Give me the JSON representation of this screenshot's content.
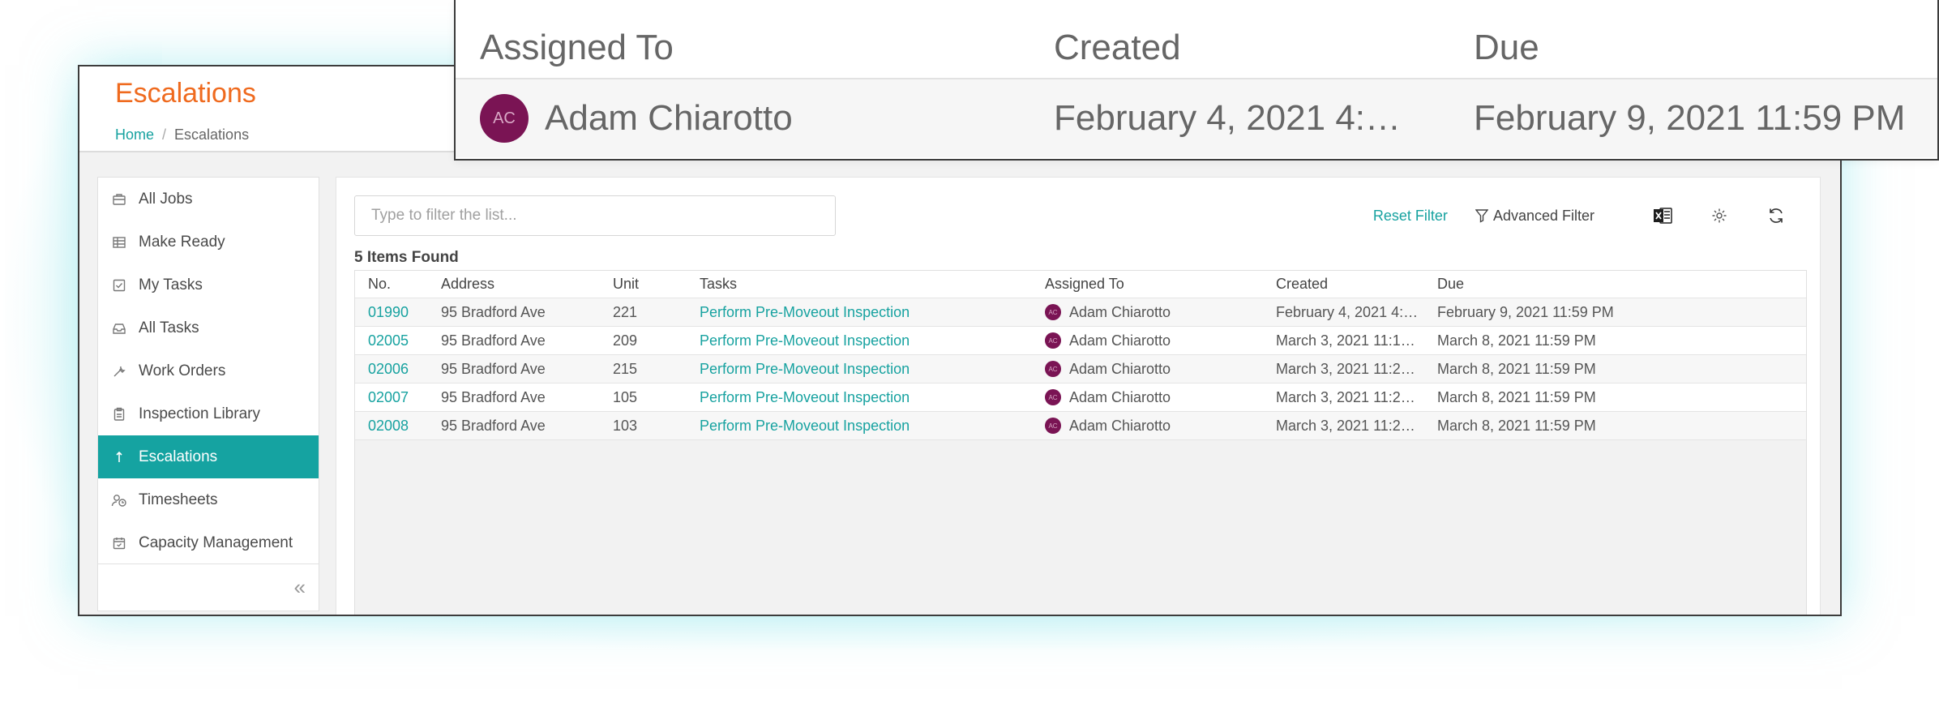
{
  "header": {
    "title": "Escalations",
    "breadcrumb": {
      "home": "Home",
      "separator": "/",
      "current": "Escalations"
    }
  },
  "sidebar": {
    "items": [
      {
        "label": "All Jobs",
        "icon": "briefcase-icon"
      },
      {
        "label": "Make Ready",
        "icon": "grid-icon"
      },
      {
        "label": "My Tasks",
        "icon": "checkbox-icon"
      },
      {
        "label": "All Tasks",
        "icon": "inbox-icon"
      },
      {
        "label": "Work Orders",
        "icon": "wrench-icon"
      },
      {
        "label": "Inspection Library",
        "icon": "clipboard-icon"
      },
      {
        "label": "Escalations",
        "icon": "escalate-arrow-icon",
        "active": true
      },
      {
        "label": "Timesheets",
        "icon": "user-clock-icon"
      },
      {
        "label": "Capacity Management",
        "icon": "calendar-icon"
      }
    ],
    "collapse_label": "«"
  },
  "toolbar": {
    "filter_placeholder": "Type to filter the list...",
    "reset_filter": "Reset Filter",
    "advanced_filter": "Advanced Filter",
    "icons": [
      "excel-export-icon",
      "settings-icon",
      "refresh-icon"
    ]
  },
  "list": {
    "items_found": "5 Items Found",
    "columns": {
      "no": "No.",
      "address": "Address",
      "unit": "Unit",
      "tasks": "Tasks",
      "assigned": "Assigned To",
      "created": "Created",
      "due": "Due"
    },
    "rows": [
      {
        "no": "01990",
        "address": "95 Bradford Ave",
        "unit": "221",
        "task": "Perform Pre-Moveout Inspection",
        "initials": "AC",
        "assigned": "Adam Chiarotto",
        "created": "February 4, 2021 4:…",
        "due": "February 9, 2021 11:59 PM"
      },
      {
        "no": "02005",
        "address": "95 Bradford Ave",
        "unit": "209",
        "task": "Perform Pre-Moveout Inspection",
        "initials": "AC",
        "assigned": "Adam Chiarotto",
        "created": "March 3, 2021 11:1…",
        "due": "March 8, 2021 11:59 PM"
      },
      {
        "no": "02006",
        "address": "95 Bradford Ave",
        "unit": "215",
        "task": "Perform Pre-Moveout Inspection",
        "initials": "AC",
        "assigned": "Adam Chiarotto",
        "created": "March 3, 2021 11:2…",
        "due": "March 8, 2021 11:59 PM"
      },
      {
        "no": "02007",
        "address": "95 Bradford Ave",
        "unit": "105",
        "task": "Perform Pre-Moveout Inspection",
        "initials": "AC",
        "assigned": "Adam Chiarotto",
        "created": "March 3, 2021 11:2…",
        "due": "March 8, 2021 11:59 PM"
      },
      {
        "no": "02008",
        "address": "95 Bradford Ave",
        "unit": "103",
        "task": "Perform Pre-Moveout Inspection",
        "initials": "AC",
        "assigned": "Adam Chiarotto",
        "created": "March 3, 2021 11:2…",
        "due": "March 8, 2021 11:59 PM"
      }
    ]
  },
  "zoom": {
    "columns": {
      "assigned": "Assigned To",
      "created": "Created",
      "due": "Due"
    },
    "row": {
      "initials": "AC",
      "assigned": "Adam Chiarotto",
      "created": "February 4, 2021 4:…",
      "due": "February 9, 2021 11:59 PM"
    }
  },
  "colors": {
    "accent": "#17a2a0",
    "title": "#ef6a1e",
    "active_nav": "#15a3a1",
    "avatar": "#7a1454"
  }
}
